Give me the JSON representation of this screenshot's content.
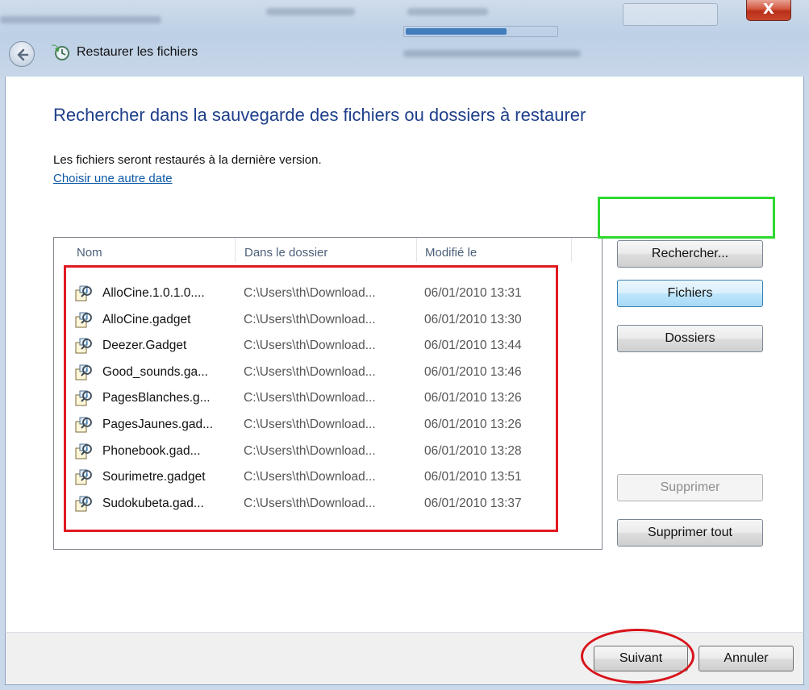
{
  "window": {
    "title": "Restaurer les fichiers",
    "close_label": "X"
  },
  "page": {
    "heading": "Rechercher dans la sauvegarde des fichiers ou dossiers à restaurer",
    "info": "Les fichiers seront restaurés à la dernière version.",
    "date_link": "Choisir une autre date"
  },
  "list": {
    "columns": [
      "Nom",
      "Dans le dossier",
      "Modifié le"
    ],
    "rows": [
      {
        "name": "AlloCine.1.0.1.0....",
        "folder": "C:\\Users\\th\\Download...",
        "modified": "06/01/2010 13:31"
      },
      {
        "name": "AlloCine.gadget",
        "folder": "C:\\Users\\th\\Download...",
        "modified": "06/01/2010 13:30"
      },
      {
        "name": "Deezer.Gadget",
        "folder": "C:\\Users\\th\\Download...",
        "modified": "06/01/2010 13:44"
      },
      {
        "name": "Good_sounds.ga...",
        "folder": "C:\\Users\\th\\Download...",
        "modified": "06/01/2010 13:46"
      },
      {
        "name": "PagesBlanches.g...",
        "folder": "C:\\Users\\th\\Download...",
        "modified": "06/01/2010 13:26"
      },
      {
        "name": "PagesJaunes.gad...",
        "folder": "C:\\Users\\th\\Download...",
        "modified": "06/01/2010 13:26"
      },
      {
        "name": "Phonebook.gad...",
        "folder": "C:\\Users\\th\\Download...",
        "modified": "06/01/2010 13:28"
      },
      {
        "name": "Sourimetre.gadget",
        "folder": "C:\\Users\\th\\Download...",
        "modified": "06/01/2010 13:51"
      },
      {
        "name": "Sudokubeta.gad...",
        "folder": "C:\\Users\\th\\Download...",
        "modified": "06/01/2010 13:37"
      }
    ]
  },
  "buttons": {
    "search": "Rechercher...",
    "files": "Fichiers",
    "folders": "Dossiers",
    "remove": "Supprimer",
    "remove_all": "Supprimer tout",
    "next": "Suivant",
    "cancel": "Annuler"
  },
  "colors": {
    "heading": "#1e3f8a",
    "link": "#0c5aa8",
    "highlight_red": "#e01a22",
    "highlight_green": "#2ed82e"
  }
}
